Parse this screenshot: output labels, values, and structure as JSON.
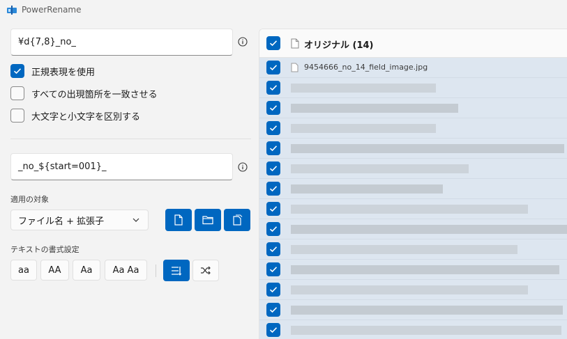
{
  "app": {
    "title": "PowerRename"
  },
  "search": {
    "value": "¥d{7,8}_no_"
  },
  "replace": {
    "value": "_no_${start=001}_"
  },
  "options": [
    {
      "label": "正規表現を使用",
      "checked": true
    },
    {
      "label": "すべての出現箇所を一致させる",
      "checked": false
    },
    {
      "label": "大文字と小文字を区別する",
      "checked": false
    }
  ],
  "apply_to": {
    "label": "適用の対象",
    "selected": "ファイル名 + 拡張子",
    "buttons": [
      "file-icon",
      "folder-icon",
      "subfolder-icon"
    ]
  },
  "text_format": {
    "label": "テキストの書式設定",
    "case_buttons": [
      "aa",
      "AA",
      "Aa",
      "Aa Aa"
    ],
    "toggles": [
      "enumerate-icon",
      "shuffle-icon"
    ]
  },
  "list": {
    "header": "オリジナル (14)",
    "first_item": "9454666_no_14_field_image.jpg"
  },
  "colors": {
    "accent": "#0067c0",
    "row_bg": "#dde6f0"
  }
}
